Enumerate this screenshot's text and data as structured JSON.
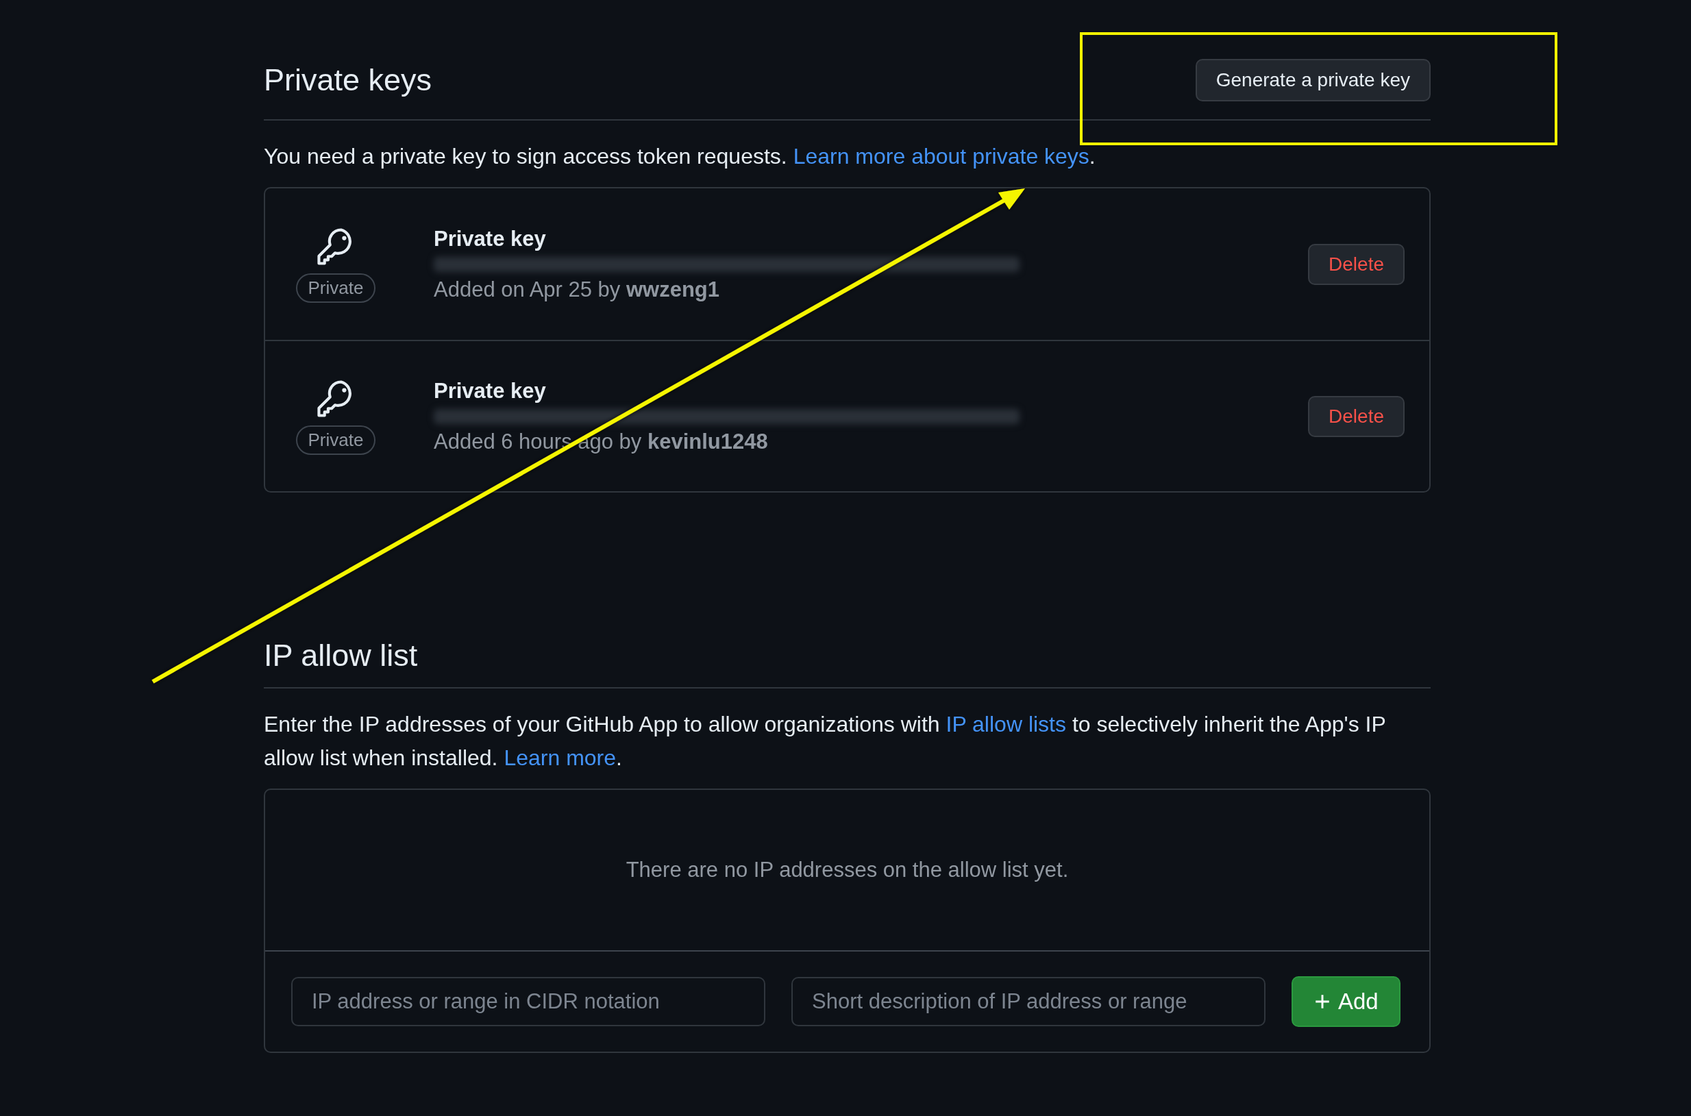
{
  "private_keys": {
    "title": "Private keys",
    "button": "Generate a private key",
    "description": [
      {
        "kind": "text",
        "text": "You need a private key to sign access token requests. "
      },
      {
        "kind": "link",
        "text": "Learn more about private keys"
      },
      {
        "kind": "text",
        "text": "."
      }
    ],
    "keys": [
      {
        "title": "Private key",
        "badge": "Private",
        "added": "Added on Apr 25 by",
        "author": "wwzeng1",
        "action": "Delete"
      },
      {
        "title": "Private key",
        "badge": "Private",
        "added": "Added 6 hours ago by",
        "author": "kevinlu1248",
        "action": "Delete"
      }
    ]
  },
  "ip_allow_list": {
    "title": "IP allow list",
    "description": [
      {
        "kind": "text",
        "text": "Enter the IP addresses of your GitHub App to allow organizations with "
      },
      {
        "kind": "link",
        "text": "IP allow lists"
      },
      {
        "kind": "text",
        "text": " to selectively inherit the App's IP allow list when installed. "
      },
      {
        "kind": "link",
        "text": "Learn more"
      },
      {
        "kind": "text",
        "text": "."
      }
    ],
    "empty_message": "There are no IP addresses on the allow list yet.",
    "address_field": {
      "placeholder": "IP address or range in CIDR notation"
    },
    "description_field": {
      "placeholder": "Short description of IP address or range"
    },
    "add_button": "Add"
  }
}
